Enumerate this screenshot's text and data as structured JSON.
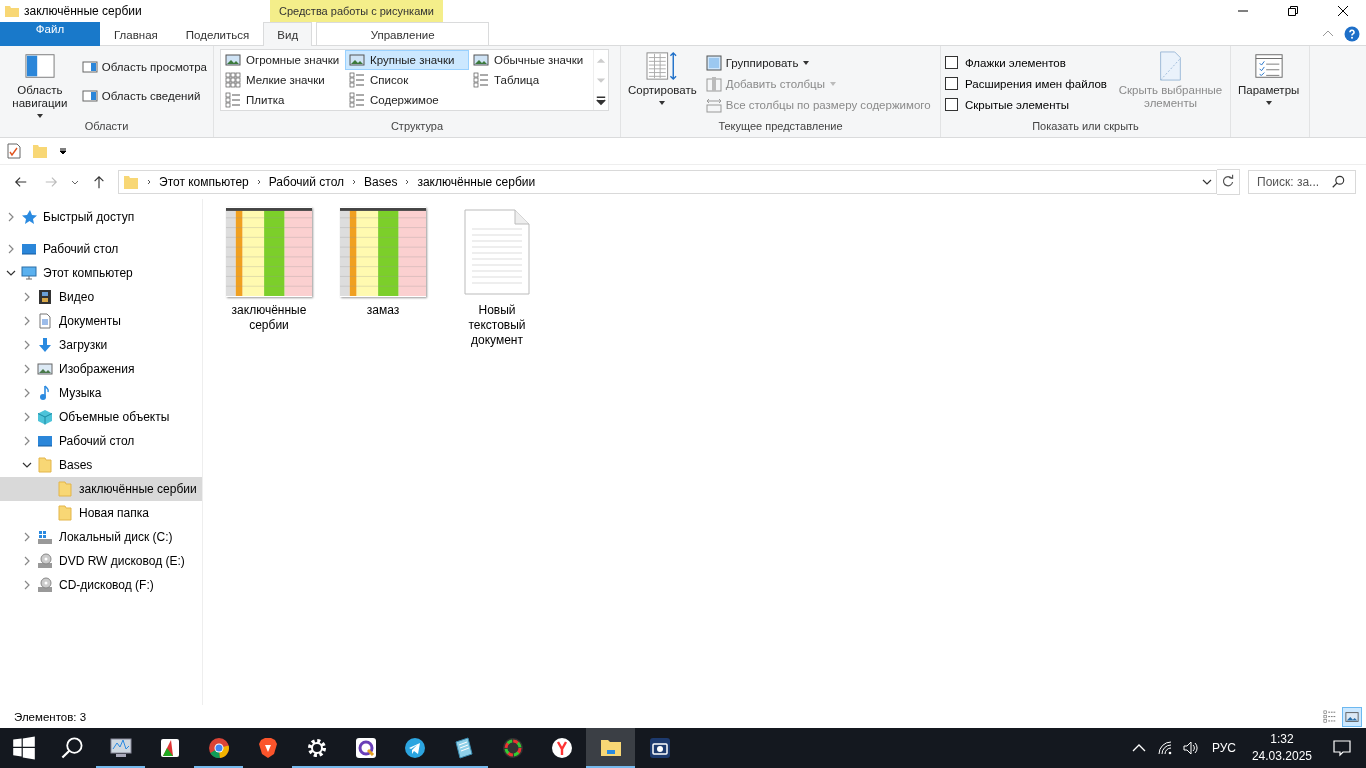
{
  "window": {
    "title": "заключённые сербии"
  },
  "ribbon_tabs": [
    {
      "label": "Файл",
      "kind": "file",
      "selected": false
    },
    {
      "label": "Главная",
      "kind": "normal",
      "selected": false
    },
    {
      "label": "Поделиться",
      "kind": "normal",
      "selected": false
    },
    {
      "label": "Вид",
      "kind": "normal",
      "selected": true
    }
  ],
  "contextual_tab": {
    "group_label": "Средства работы с рисунками",
    "label": "Управление"
  },
  "panes": {
    "label": "Области",
    "nav_button": "Область навигации",
    "items": [
      "Область просмотра",
      "Область сведений"
    ]
  },
  "layout": {
    "label": "Структура",
    "options": [
      {
        "label": "Огромные значки",
        "kind": "huge",
        "selected": false
      },
      {
        "label": "Крупные значки",
        "kind": "large",
        "selected": true
      },
      {
        "label": "Обычные значки",
        "kind": "medium",
        "selected": false
      },
      {
        "label": "Мелкие значки",
        "kind": "small",
        "selected": false
      },
      {
        "label": "Список",
        "kind": "list",
        "selected": false
      },
      {
        "label": "Таблица",
        "kind": "details",
        "selected": false
      },
      {
        "label": "Плитка",
        "kind": "tiles",
        "selected": false
      },
      {
        "label": "Содержимое",
        "kind": "content",
        "selected": false
      }
    ]
  },
  "current_view": {
    "label": "Текущее представление",
    "sort": "Сортировать",
    "items": [
      {
        "label": "Группировать",
        "kind": "group",
        "disabled": false
      },
      {
        "label": "Добавить столбцы",
        "kind": "columns",
        "disabled": true
      },
      {
        "label": "Все столбцы по размеру содержимого",
        "kind": "fit",
        "disabled": true
      }
    ]
  },
  "show_hide": {
    "label": "Показать или скрыть",
    "checkboxes": [
      {
        "label": "Флажки элементов",
        "checked": false
      },
      {
        "label": "Расширения имен файлов",
        "checked": false
      },
      {
        "label": "Скрытые элементы",
        "checked": false
      }
    ],
    "hide_button": {
      "label": "Скрыть выбранные элементы",
      "disabled": true
    }
  },
  "options": {
    "label": "Параметры"
  },
  "address": {
    "path": [
      "Этот компьютер",
      "Рабочий стол",
      "Bases",
      "заключённые сербии"
    ],
    "search_placeholder": "Поиск: за..."
  },
  "nav_tree": [
    {
      "label": "Быстрый доступ",
      "kind": "star",
      "expandable": true,
      "expanded": false,
      "selected": false
    },
    {
      "label": "Рабочий стол",
      "kind": "desktop",
      "expandable": true,
      "expanded": false,
      "selected": false
    },
    {
      "label": "Этот компьютер",
      "kind": "pc",
      "expandable": true,
      "expanded": true,
      "selected": false,
      "children": [
        {
          "label": "Видео",
          "kind": "video",
          "expandable": true,
          "expanded": false,
          "selected": false
        },
        {
          "label": "Документы",
          "kind": "docs",
          "expandable": true,
          "expanded": false,
          "selected": false
        },
        {
          "label": "Загрузки",
          "kind": "download",
          "expandable": true,
          "expanded": false,
          "selected": false
        },
        {
          "label": "Изображения",
          "kind": "images",
          "expandable": true,
          "expanded": false,
          "selected": false
        },
        {
          "label": "Музыка",
          "kind": "music",
          "expandable": true,
          "expanded": false,
          "selected": false
        },
        {
          "label": "Объемные объекты",
          "kind": "cube",
          "expandable": true,
          "expanded": false,
          "selected": false
        },
        {
          "label": "Рабочий стол",
          "kind": "desktop",
          "expandable": true,
          "expanded": false,
          "selected": false
        },
        {
          "label": "Bases",
          "kind": "folder",
          "expandable": true,
          "expanded": true,
          "selected": false,
          "children": [
            {
              "label": "заключённые сербии",
              "kind": "folder",
              "expandable": false,
              "selected": true
            },
            {
              "label": "Новая папка",
              "kind": "folder",
              "expandable": false,
              "selected": false
            }
          ]
        },
        {
          "label": "Локальный диск (C:)",
          "kind": "drive",
          "expandable": true,
          "expanded": false,
          "selected": false
        },
        {
          "label": "DVD RW дисковод (E:)",
          "kind": "disc",
          "expandable": true,
          "expanded": false,
          "selected": false
        },
        {
          "label": "CD-дисковод (F:)",
          "kind": "disc",
          "expandable": true,
          "expanded": false,
          "selected": false
        }
      ]
    }
  ],
  "files": [
    {
      "name": "заключённые сербии",
      "kind": "spreadsheet"
    },
    {
      "name": "замаз",
      "kind": "spreadsheet"
    },
    {
      "name": "Новый текстовый документ",
      "kind": "text"
    }
  ],
  "status_bar": {
    "count": "Элементов: 3",
    "views": [
      {
        "kind": "details",
        "selected": false
      },
      {
        "kind": "large",
        "selected": true
      }
    ]
  },
  "taskbar": {
    "apps": [
      {
        "kind": "monitor",
        "running": true,
        "active": false
      },
      {
        "kind": "archive",
        "running": false,
        "active": false
      },
      {
        "kind": "chrome",
        "running": true,
        "active": false
      },
      {
        "kind": "brave",
        "running": false,
        "active": false
      },
      {
        "kind": "gear",
        "running": true,
        "active": false
      },
      {
        "kind": "qapp",
        "running": true,
        "active": false
      },
      {
        "kind": "telegram",
        "running": true,
        "active": false
      },
      {
        "kind": "notepad",
        "running": true,
        "active": false
      },
      {
        "kind": "color",
        "running": false,
        "active": false
      },
      {
        "kind": "yandex",
        "running": false,
        "active": false
      },
      {
        "kind": "explorer",
        "running": true,
        "active": true
      },
      {
        "kind": "camera",
        "running": false,
        "active": false
      }
    ],
    "language": "РУС",
    "time": "1:32",
    "date": "24.03.2025"
  }
}
